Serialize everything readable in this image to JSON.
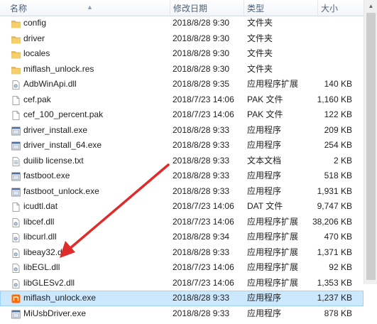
{
  "columns": {
    "name": "名称",
    "date": "修改日期",
    "type": "类型",
    "size": "大小"
  },
  "colors": {
    "selection": "#cce8ff",
    "arrow": "#e02b2b",
    "folder": "#e8b94a"
  },
  "files": [
    {
      "icon": "folder-icon",
      "name": "config",
      "date": "2018/8/28 9:30",
      "type": "文件夹",
      "size": ""
    },
    {
      "icon": "folder-icon",
      "name": "driver",
      "date": "2018/8/28 9:30",
      "type": "文件夹",
      "size": ""
    },
    {
      "icon": "folder-icon",
      "name": "locales",
      "date": "2018/8/28 9:30",
      "type": "文件夹",
      "size": ""
    },
    {
      "icon": "folder-icon",
      "name": "miflash_unlock.res",
      "date": "2018/8/28 9:30",
      "type": "文件夹",
      "size": ""
    },
    {
      "icon": "dll-icon",
      "name": "AdbWinApi.dll",
      "date": "2018/8/28 9:35",
      "type": "应用程序扩展",
      "size": "140 KB"
    },
    {
      "icon": "file-icon",
      "name": "cef.pak",
      "date": "2018/7/23 14:06",
      "type": "PAK 文件",
      "size": "1,160 KB"
    },
    {
      "icon": "file-icon",
      "name": "cef_100_percent.pak",
      "date": "2018/7/23 14:06",
      "type": "PAK 文件",
      "size": "122 KB"
    },
    {
      "icon": "exe-icon",
      "name": "driver_install.exe",
      "date": "2018/8/28 9:33",
      "type": "应用程序",
      "size": "209 KB"
    },
    {
      "icon": "exe-icon",
      "name": "driver_install_64.exe",
      "date": "2018/8/28 9:33",
      "type": "应用程序",
      "size": "254 KB"
    },
    {
      "icon": "text-file-icon",
      "name": "duilib license.txt",
      "date": "2018/8/28 9:33",
      "type": "文本文档",
      "size": "2 KB"
    },
    {
      "icon": "exe-icon",
      "name": "fastboot.exe",
      "date": "2018/8/28 9:33",
      "type": "应用程序",
      "size": "518 KB"
    },
    {
      "icon": "exe-icon",
      "name": "fastboot_unlock.exe",
      "date": "2018/8/28 9:33",
      "type": "应用程序",
      "size": "1,931 KB"
    },
    {
      "icon": "file-icon",
      "name": "icudtl.dat",
      "date": "2018/7/23 14:06",
      "type": "DAT 文件",
      "size": "9,747 KB"
    },
    {
      "icon": "dll-icon",
      "name": "libcef.dll",
      "date": "2018/7/23 14:06",
      "type": "应用程序扩展",
      "size": "38,206 KB"
    },
    {
      "icon": "dll-icon",
      "name": "libcurl.dll",
      "date": "2018/8/28 9:34",
      "type": "应用程序扩展",
      "size": "470 KB"
    },
    {
      "icon": "dll-icon",
      "name": "libeay32.dll",
      "date": "2018/8/28 9:33",
      "type": "应用程序扩展",
      "size": "1,371 KB"
    },
    {
      "icon": "dll-icon",
      "name": "libEGL.dll",
      "date": "2018/7/23 14:06",
      "type": "应用程序扩展",
      "size": "92 KB"
    },
    {
      "icon": "dll-icon",
      "name": "libGLESv2.dll",
      "date": "2018/7/23 14:06",
      "type": "应用程序扩展",
      "size": "1,353 KB"
    },
    {
      "icon": "app-icon",
      "name": "miflash_unlock.exe",
      "date": "2018/8/28 9:33",
      "type": "应用程序",
      "size": "1,237 KB",
      "selected": true
    },
    {
      "icon": "exe-icon",
      "name": "MiUsbDriver.exe",
      "date": "2018/8/28 9:33",
      "type": "应用程序",
      "size": "878 KB"
    }
  ]
}
